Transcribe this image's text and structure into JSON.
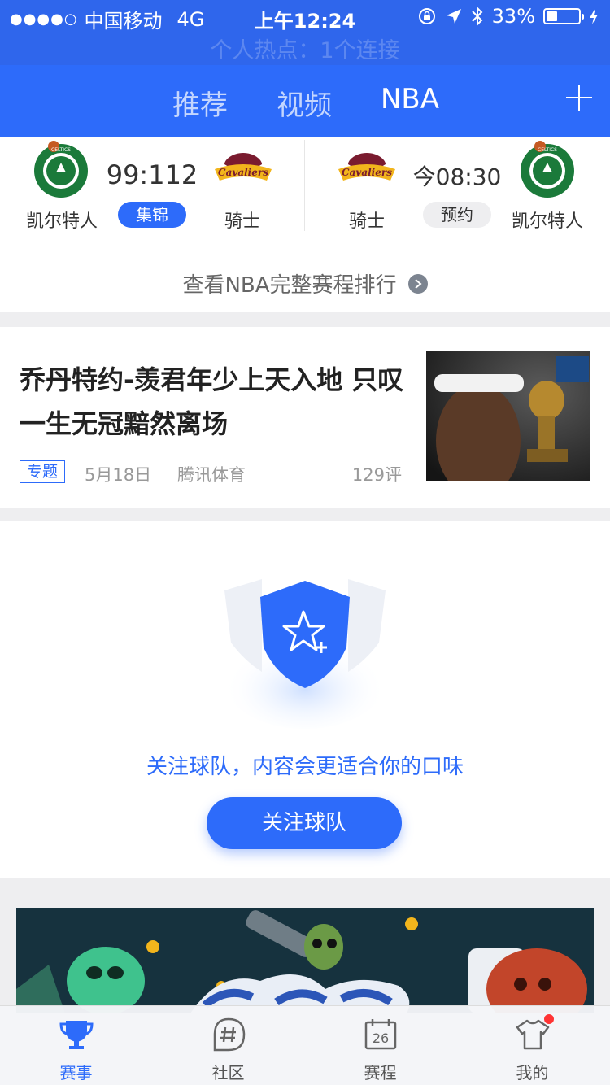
{
  "status_bar": {
    "signal": "●●●●○",
    "carrier": "中国移动",
    "network": "4G",
    "time": "上午12:24",
    "battery_text": "33%",
    "battery_level": 0.33,
    "hotspot": "个人热点：1个连接"
  },
  "nav": {
    "tabs": [
      {
        "label": "推荐"
      },
      {
        "label": "视频"
      },
      {
        "label": "NBA"
      }
    ],
    "active_tab": "NBA"
  },
  "games": [
    {
      "home": "凯尔特人",
      "away": "骑士",
      "score": "99:112",
      "action": "集锦"
    },
    {
      "home": "骑士",
      "away": "凯尔特人",
      "score": "今08:30",
      "action": "预约"
    }
  ],
  "schedule_link": "查看NBA完整赛程排行",
  "article": {
    "title": "乔丹特约-羡君年少上天入地 只叹一生无冠黯然离场",
    "tag": "专题",
    "date": "5月18日",
    "source": "腾讯体育",
    "comments": "129评"
  },
  "follow": {
    "text": "关注球队，内容会更适合你的口味",
    "button": "关注球队"
  },
  "tabbar": {
    "items": [
      {
        "label": "赛事"
      },
      {
        "label": "社区"
      },
      {
        "label": "赛程",
        "icon_number": "26"
      },
      {
        "label": "我的"
      }
    ]
  },
  "colors": {
    "accent": "#2d6bfa",
    "statusbar": "#2f66ec",
    "celtics_green": "#1b7a3a",
    "cavs_wine": "#7a1b2f",
    "cavs_gold": "#f2b51c",
    "badge_red": "#ff3333"
  }
}
